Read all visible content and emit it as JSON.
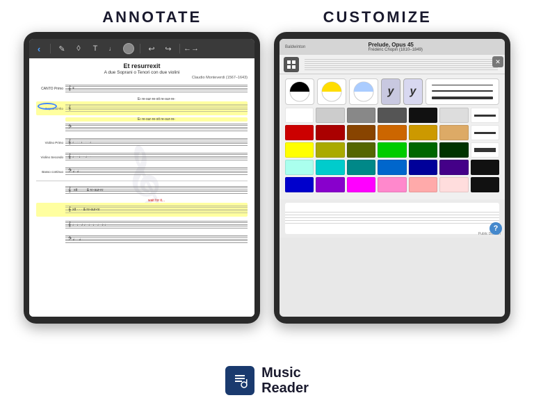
{
  "header": {
    "annotate_label": "ANNOTATE",
    "customize_label": "CUSTOMIZE"
  },
  "left_tablet": {
    "toolbar": {
      "chevron_label": "‹",
      "tools": [
        "✎",
        "◊",
        "T",
        "♩",
        "●",
        "↩",
        "↪",
        "←→"
      ]
    },
    "sheet": {
      "title": "Et resurrexit",
      "subtitle": "A due Soprani o Tenori con due violini",
      "composer": "Claudio Monteverdi (1567–1643)",
      "rows": [
        {
          "label": "CANTO Primo",
          "highlighted": false
        },
        {
          "label": "Soprano/Alto",
          "highlighted": true
        },
        {
          "label": "",
          "highlighted": false
        },
        {
          "label": "Violino Primo",
          "highlighted": false
        },
        {
          "label": "Violino Secondo",
          "highlighted": false
        },
        {
          "label": "Basso continuo",
          "highlighted": false
        }
      ],
      "lyric_normal": "re - sur - re - xit    re-sur-re-",
      "lyric_wait": "wait for it...",
      "lyric_bottom": "re - sur - re - xit"
    }
  },
  "right_tablet": {
    "sheet_title": "Prelude, Opus 45",
    "composer": "Frédéric Chopin (1810–1849)",
    "location_label": "Baldwinton",
    "palette": {
      "top_row": [
        {
          "type": "half-circle-bw",
          "label": "black-white pen"
        },
        {
          "type": "half-circle-yellow",
          "label": "yellow pen"
        },
        {
          "type": "half-circle-blue",
          "label": "blue pen"
        },
        {
          "type": "italic-y",
          "label": "italic y button"
        },
        {
          "type": "italic-y2",
          "label": "italic y button 2"
        }
      ],
      "colors": [
        "#ffffff",
        "#cccccc",
        "#888888",
        "#444444",
        "#000000",
        "#dddddd",
        "",
        "#cc0000",
        "#aa0000",
        "#884400",
        "#cc6600",
        "#ddaa00",
        "#eecc88",
        "",
        "#ffff00",
        "#aaaa00",
        "#556600",
        "#00cc00",
        "#006600",
        "#003300",
        "",
        "#aaffee",
        "#00cccc",
        "#008888",
        "#0066cc",
        "#000099",
        "#440088",
        "",
        "#0000cc",
        "#8800cc",
        "#ff00ff",
        "#ff88cc",
        "#ffaaaa",
        "#ffcccc",
        ""
      ],
      "line_styles": [
        "thin",
        "medium",
        "thick",
        "xthick"
      ],
      "right_swatches": [
        "white-thin",
        "white-medium",
        "white-thick",
        "white-xthick",
        "black-block"
      ]
    },
    "bottom_label": "Public Domain",
    "help_label": "?"
  },
  "logo": {
    "icon": "🎵",
    "name_line1": "Music",
    "name_line2": "Reader"
  }
}
